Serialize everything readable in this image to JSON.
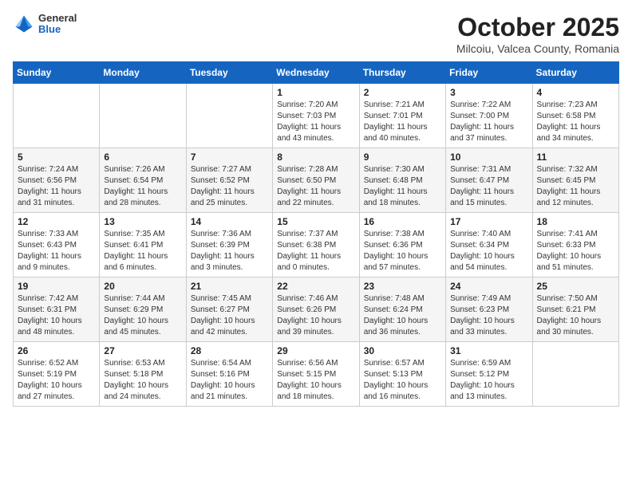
{
  "header": {
    "logo": {
      "general": "General",
      "blue": "Blue"
    },
    "title": "October 2025",
    "location": "Milcoiu, Valcea County, Romania"
  },
  "weekdays": [
    "Sunday",
    "Monday",
    "Tuesday",
    "Wednesday",
    "Thursday",
    "Friday",
    "Saturday"
  ],
  "weeks": [
    [
      null,
      null,
      null,
      {
        "day": "1",
        "sunrise": "Sunrise: 7:20 AM",
        "sunset": "Sunset: 7:03 PM",
        "daylight": "Daylight: 11 hours and 43 minutes."
      },
      {
        "day": "2",
        "sunrise": "Sunrise: 7:21 AM",
        "sunset": "Sunset: 7:01 PM",
        "daylight": "Daylight: 11 hours and 40 minutes."
      },
      {
        "day": "3",
        "sunrise": "Sunrise: 7:22 AM",
        "sunset": "Sunset: 7:00 PM",
        "daylight": "Daylight: 11 hours and 37 minutes."
      },
      {
        "day": "4",
        "sunrise": "Sunrise: 7:23 AM",
        "sunset": "Sunset: 6:58 PM",
        "daylight": "Daylight: 11 hours and 34 minutes."
      }
    ],
    [
      {
        "day": "5",
        "sunrise": "Sunrise: 7:24 AM",
        "sunset": "Sunset: 6:56 PM",
        "daylight": "Daylight: 11 hours and 31 minutes."
      },
      {
        "day": "6",
        "sunrise": "Sunrise: 7:26 AM",
        "sunset": "Sunset: 6:54 PM",
        "daylight": "Daylight: 11 hours and 28 minutes."
      },
      {
        "day": "7",
        "sunrise": "Sunrise: 7:27 AM",
        "sunset": "Sunset: 6:52 PM",
        "daylight": "Daylight: 11 hours and 25 minutes."
      },
      {
        "day": "8",
        "sunrise": "Sunrise: 7:28 AM",
        "sunset": "Sunset: 6:50 PM",
        "daylight": "Daylight: 11 hours and 22 minutes."
      },
      {
        "day": "9",
        "sunrise": "Sunrise: 7:30 AM",
        "sunset": "Sunset: 6:48 PM",
        "daylight": "Daylight: 11 hours and 18 minutes."
      },
      {
        "day": "10",
        "sunrise": "Sunrise: 7:31 AM",
        "sunset": "Sunset: 6:47 PM",
        "daylight": "Daylight: 11 hours and 15 minutes."
      },
      {
        "day": "11",
        "sunrise": "Sunrise: 7:32 AM",
        "sunset": "Sunset: 6:45 PM",
        "daylight": "Daylight: 11 hours and 12 minutes."
      }
    ],
    [
      {
        "day": "12",
        "sunrise": "Sunrise: 7:33 AM",
        "sunset": "Sunset: 6:43 PM",
        "daylight": "Daylight: 11 hours and 9 minutes."
      },
      {
        "day": "13",
        "sunrise": "Sunrise: 7:35 AM",
        "sunset": "Sunset: 6:41 PM",
        "daylight": "Daylight: 11 hours and 6 minutes."
      },
      {
        "day": "14",
        "sunrise": "Sunrise: 7:36 AM",
        "sunset": "Sunset: 6:39 PM",
        "daylight": "Daylight: 11 hours and 3 minutes."
      },
      {
        "day": "15",
        "sunrise": "Sunrise: 7:37 AM",
        "sunset": "Sunset: 6:38 PM",
        "daylight": "Daylight: 11 hours and 0 minutes."
      },
      {
        "day": "16",
        "sunrise": "Sunrise: 7:38 AM",
        "sunset": "Sunset: 6:36 PM",
        "daylight": "Daylight: 10 hours and 57 minutes."
      },
      {
        "day": "17",
        "sunrise": "Sunrise: 7:40 AM",
        "sunset": "Sunset: 6:34 PM",
        "daylight": "Daylight: 10 hours and 54 minutes."
      },
      {
        "day": "18",
        "sunrise": "Sunrise: 7:41 AM",
        "sunset": "Sunset: 6:33 PM",
        "daylight": "Daylight: 10 hours and 51 minutes."
      }
    ],
    [
      {
        "day": "19",
        "sunrise": "Sunrise: 7:42 AM",
        "sunset": "Sunset: 6:31 PM",
        "daylight": "Daylight: 10 hours and 48 minutes."
      },
      {
        "day": "20",
        "sunrise": "Sunrise: 7:44 AM",
        "sunset": "Sunset: 6:29 PM",
        "daylight": "Daylight: 10 hours and 45 minutes."
      },
      {
        "day": "21",
        "sunrise": "Sunrise: 7:45 AM",
        "sunset": "Sunset: 6:27 PM",
        "daylight": "Daylight: 10 hours and 42 minutes."
      },
      {
        "day": "22",
        "sunrise": "Sunrise: 7:46 AM",
        "sunset": "Sunset: 6:26 PM",
        "daylight": "Daylight: 10 hours and 39 minutes."
      },
      {
        "day": "23",
        "sunrise": "Sunrise: 7:48 AM",
        "sunset": "Sunset: 6:24 PM",
        "daylight": "Daylight: 10 hours and 36 minutes."
      },
      {
        "day": "24",
        "sunrise": "Sunrise: 7:49 AM",
        "sunset": "Sunset: 6:23 PM",
        "daylight": "Daylight: 10 hours and 33 minutes."
      },
      {
        "day": "25",
        "sunrise": "Sunrise: 7:50 AM",
        "sunset": "Sunset: 6:21 PM",
        "daylight": "Daylight: 10 hours and 30 minutes."
      }
    ],
    [
      {
        "day": "26",
        "sunrise": "Sunrise: 6:52 AM",
        "sunset": "Sunset: 5:19 PM",
        "daylight": "Daylight: 10 hours and 27 minutes."
      },
      {
        "day": "27",
        "sunrise": "Sunrise: 6:53 AM",
        "sunset": "Sunset: 5:18 PM",
        "daylight": "Daylight: 10 hours and 24 minutes."
      },
      {
        "day": "28",
        "sunrise": "Sunrise: 6:54 AM",
        "sunset": "Sunset: 5:16 PM",
        "daylight": "Daylight: 10 hours and 21 minutes."
      },
      {
        "day": "29",
        "sunrise": "Sunrise: 6:56 AM",
        "sunset": "Sunset: 5:15 PM",
        "daylight": "Daylight: 10 hours and 18 minutes."
      },
      {
        "day": "30",
        "sunrise": "Sunrise: 6:57 AM",
        "sunset": "Sunset: 5:13 PM",
        "daylight": "Daylight: 10 hours and 16 minutes."
      },
      {
        "day": "31",
        "sunrise": "Sunrise: 6:59 AM",
        "sunset": "Sunset: 5:12 PM",
        "daylight": "Daylight: 10 hours and 13 minutes."
      },
      null
    ]
  ]
}
